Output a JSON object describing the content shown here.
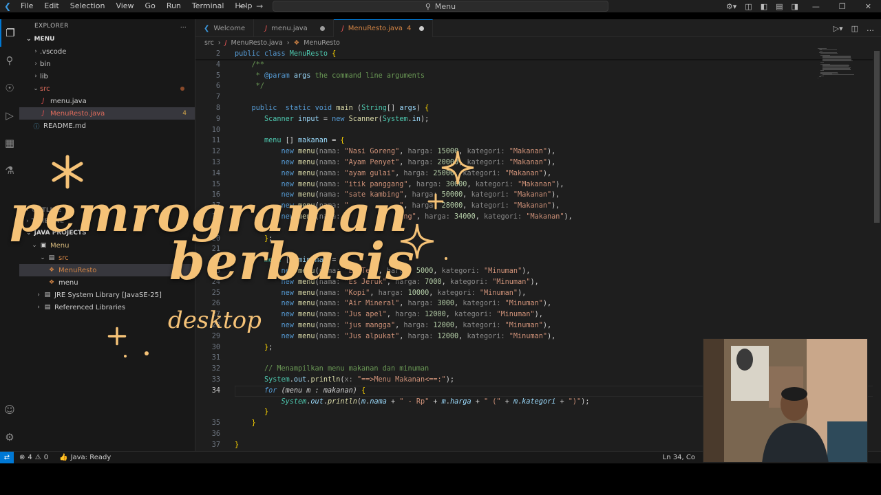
{
  "titlebar": {
    "menu": [
      "File",
      "Edit",
      "Selection",
      "View",
      "Go",
      "Run",
      "Terminal",
      "Help"
    ],
    "search": "Menu"
  },
  "sidebar": {
    "header": "EXPLORER",
    "folder": "MENU",
    "files": [
      {
        "label": ".vscode",
        "type": "folder"
      },
      {
        "label": "bin",
        "type": "folder"
      },
      {
        "label": "lib",
        "type": "folder"
      },
      {
        "label": "src",
        "type": "folder-open"
      },
      {
        "label": "menu.java",
        "type": "java"
      },
      {
        "label": "MenuResto.java",
        "type": "java",
        "badge": "4"
      },
      {
        "label": "README.md",
        "type": "md"
      }
    ],
    "outline_label": "OUTLINE",
    "timeline_label": "TIMELINE",
    "java_projects": "JAVA PROJECTS",
    "projects": [
      {
        "label": "Menu"
      },
      {
        "label": "src"
      },
      {
        "label": "MenuResto"
      },
      {
        "label": "menu"
      },
      {
        "label": "JRE System Library [JavaSE-25]"
      },
      {
        "label": "Referenced Libraries"
      }
    ]
  },
  "tabs": [
    {
      "label": "Welcome"
    },
    {
      "label": "menu.java"
    },
    {
      "label": "MenuResto.java",
      "badge": "4"
    }
  ],
  "breadcrumb": {
    "a": "src",
    "b": "MenuResto.java",
    "c": "MenuResto"
  },
  "status": {
    "errors": "4",
    "warnings": "0",
    "java": "Java: Ready",
    "position": "Ln 34, Co"
  },
  "overlay": {
    "line1": "pemrograman",
    "line2": "berbasis",
    "line3": "desktop"
  },
  "colors": {
    "accent": "#0078d4",
    "overlay_text": "#f5c277"
  },
  "code": [
    {
      "n": "2",
      "html": "<span class='kw'>public</span> <span class='kw'>class</span> <span class='ty'>MenuResto</span> <span class='br'>{</span>"
    },
    {
      "n": "4",
      "html": "    <span class='cm'>/**</span>"
    },
    {
      "n": "5",
      "html": "    <span class='cm'> * </span><span class='kw'>@param</span> <span class='var'>args</span><span class='cm'> the command line arguments</span>"
    },
    {
      "n": "6",
      "html": "    <span class='cm'> */</span>"
    },
    {
      "n": "7",
      "html": ""
    },
    {
      "n": "8",
      "html": "    <span class='kw'>public</span>  <span class='kw'>static</span> <span class='kw'>void</span> <span class='fn'>main</span> <span class='pl'>(</span><span class='ty'>String</span><span class='pl'>[]</span> <span class='var'>args</span><span class='pl'>)</span> <span class='br'>{</span>"
    },
    {
      "n": "9",
      "html": "       <span class='ty'>Scanner</span> <span class='var'>input</span> <span class='pl'>=</span> <span class='kw'>new</span> <span class='fn'>Scanner</span><span class='pl'>(</span><span class='ty'>System</span><span class='pl'>.</span><span class='var'>in</span><span class='pl'>);</span>"
    },
    {
      "n": "10",
      "html": ""
    },
    {
      "n": "11",
      "html": "       <span class='ty'>menu</span> <span class='pl'>[]</span> <span class='var'>makanan</span> <span class='pl'>=</span> <span class='br'>{</span>"
    },
    {
      "n": "12",
      "html": "           <span class='kw'>new</span> <span class='fn'>menu</span><span class='pl'>(</span><span class='hint'>nama:</span> <span class='str'>\"Nasi Goreng\"</span><span class='pl'>,</span> <span class='hint'>harga:</span> <span class='num'>15000</span><span class='pl'>,</span> <span class='hint'>kategori:</span> <span class='str'>\"Makanan\"</span><span class='pl'>),</span>"
    },
    {
      "n": "13",
      "html": "           <span class='kw'>new</span> <span class='fn'>menu</span><span class='pl'>(</span><span class='hint'>nama:</span> <span class='str'>\"Ayam Penyet\"</span><span class='pl'>,</span> <span class='hint'>harga:</span> <span class='num'>20000</span><span class='pl'>,</span> <span class='hint'>kategori:</span> <span class='str'>\"Makanan\"</span><span class='pl'>),</span>"
    },
    {
      "n": "14",
      "html": "           <span class='kw'>new</span> <span class='fn'>menu</span><span class='pl'>(</span><span class='hint'>nama:</span> <span class='str'>\"ayam gulai\"</span><span class='pl'>,</span> <span class='hint'>harga:</span> <span class='num'>25000</span><span class='pl'>,</span> <span class='hint'>kategori:</span> <span class='str'>\"Makanan\"</span><span class='pl'>),</span>"
    },
    {
      "n": "15",
      "html": "           <span class='kw'>new</span> <span class='fn'>menu</span><span class='pl'>(</span><span class='hint'>nama:</span> <span class='str'>\"itik panggang\"</span><span class='pl'>,</span> <span class='hint'>harga:</span> <span class='num'>30000</span><span class='pl'>,</span> <span class='hint'>kategori:</span> <span class='str'>\"Makanan\"</span><span class='pl'>),</span>"
    },
    {
      "n": "16",
      "html": "           <span class='kw'>new</span> <span class='fn'>menu</span><span class='pl'>(</span><span class='hint'>nama:</span> <span class='str'>\"sate kambing\"</span><span class='pl'>,</span> <span class='hint'>harga:</span> <span class='num'>50000</span><span class='pl'>,</span> <span class='hint'>kategori:</span> <span class='str'>\"Makanan\"</span><span class='pl'>),</span>"
    },
    {
      "n": "17",
      "html": "           <span class='kw'>new</span> <span class='fn'>menu</span><span class='pl'>(</span><span class='hint'>nama:</span> <span class='str'>\"            \"</span><span class='pl'>,</span> <span class='hint'>harga:</span> <span class='num'>28000</span><span class='pl'>,</span> <span class='hint'>kategori:</span> <span class='str'>\"Makanan\"</span><span class='pl'>),</span>"
    },
    {
      "n": "18",
      "html": "           <span class='kw'>new</span> <span class='fn'>menu</span><span class='pl'>(</span><span class='hint'>nama:</span> <span class='str'>\"            ang\"</span><span class='pl'>,</span> <span class='hint'>harga:</span> <span class='num'>34000</span><span class='pl'>,</span> <span class='hint'>kategori:</span> <span class='str'>\"Makanan\"</span><span class='pl'>),</span>"
    },
    {
      "n": "19",
      "html": ""
    },
    {
      "n": "20",
      "html": "       <span class='br'>}</span><span class='pl'>;</span>"
    },
    {
      "n": "21",
      "html": ""
    },
    {
      "n": "22",
      "html": "       <span class='ty'>menu</span> <span class='pl'>[]</span> <span class='var'>minuman</span> <span class='pl'>=</span> <span class='br'>{</span>"
    },
    {
      "n": "23",
      "html": "           <span class='kw'>new</span> <span class='fn'>menu</span><span class='pl'>(</span><span class='hint'>nama:</span> <span class='str'>\"Es Teh\"</span><span class='pl'>,</span> <span class='hint'>harga:</span> <span class='num'>5000</span><span class='pl'>,</span> <span class='hint'>kategori:</span> <span class='str'>\"Minuman\"</span><span class='pl'>),</span>"
    },
    {
      "n": "24",
      "html": "           <span class='kw'>new</span> <span class='fn'>menu</span><span class='pl'>(</span><span class='hint'>nama:</span> <span class='str'>\"Es Jeruk\"</span><span class='pl'>,</span> <span class='hint'>harga:</span> <span class='num'>7000</span><span class='pl'>,</span> <span class='hint'>kategori:</span> <span class='str'>\"Minuman\"</span><span class='pl'>),</span>"
    },
    {
      "n": "25",
      "html": "           <span class='kw'>new</span> <span class='fn'>menu</span><span class='pl'>(</span><span class='hint'>nama:</span> <span class='str'>\"Kopi\"</span><span class='pl'>,</span> <span class='hint'>harga:</span> <span class='num'>10000</span><span class='pl'>,</span> <span class='hint'>kategori:</span> <span class='str'>\"Minuman\"</span><span class='pl'>),</span>"
    },
    {
      "n": "26",
      "html": "           <span class='kw'>new</span> <span class='fn'>menu</span><span class='pl'>(</span><span class='hint'>nama:</span> <span class='str'>\"Air Mineral\"</span><span class='pl'>,</span> <span class='hint'>harga:</span> <span class='num'>3000</span><span class='pl'>,</span> <span class='hint'>kategori:</span> <span class='str'>\"Minuman\"</span><span class='pl'>),</span>"
    },
    {
      "n": "27",
      "html": "           <span class='kw'>new</span> <span class='fn'>menu</span><span class='pl'>(</span><span class='hint'>nama:</span> <span class='str'>\"Jus apel\"</span><span class='pl'>,</span> <span class='hint'>harga:</span> <span class='num'>12000</span><span class='pl'>,</span> <span class='hint'>kategori:</span> <span class='str'>\"Minuman\"</span><span class='pl'>),</span>"
    },
    {
      "n": "28",
      "html": "           <span class='kw'>new</span> <span class='fn'>menu</span><span class='pl'>(</span><span class='hint'>nama:</span> <span class='str'>\"jus mangga\"</span><span class='pl'>,</span> <span class='hint'>harga:</span> <span class='num'>12000</span><span class='pl'>,</span> <span class='hint'>kategori:</span> <span class='str'>\"Minuman\"</span><span class='pl'>),</span>"
    },
    {
      "n": "29",
      "html": "           <span class='kw'>new</span> <span class='fn'>menu</span><span class='pl'>(</span><span class='hint'>nama:</span> <span class='str'>\"Jus alpukat\"</span><span class='pl'>,</span> <span class='hint'>harga:</span> <span class='num'>12000</span><span class='pl'>,</span> <span class='hint'>kategori:</span> <span class='str'>\"Minuman\"</span><span class='pl'>),</span>"
    },
    {
      "n": "30",
      "html": "       <span class='br'>}</span><span class='pl'>;</span>"
    },
    {
      "n": "31",
      "html": ""
    },
    {
      "n": "32",
      "html": "       <span class='cm'>// Menampilkan menu makanan dan minuman</span>"
    },
    {
      "n": "33",
      "html": "       <span class='ty'>System</span><span class='pl'>.</span><span class='var'>out</span><span class='pl'>.</span><span class='fn'>println</span><span class='pl'>(</span><span class='hint'>x:</span> <span class='str'>\"==>Menu Makanan<==:\"</span><span class='pl'>);</span>"
    },
    {
      "n": "34",
      "html": "       <span class='kw' style='font-style:italic'>for</span> <span class='pl' style='font-style:italic'>(menu m : makanan)</span> <span class='br'>{</span>"
    },
    {
      "n": "",
      "html": "           <span class='ty' style='font-style:italic'>System</span><span class='pl'>.</span><span class='var' style='font-style:italic'>out</span><span class='pl'>.</span><span class='fn' style='font-style:italic'>println</span><span class='pl'>(</span><span class='var' style='font-style:italic'>m</span><span class='pl'>.</span><span class='var' style='font-style:italic'>nama</span> <span class='pl'>+</span> <span class='str'>\" - Rp\"</span> <span class='pl'>+</span> <span class='var' style='font-style:italic'>m</span><span class='pl'>.</span><span class='var' style='font-style:italic'>harga</span> <span class='pl'>+</span> <span class='str'>\" (\"</span> <span class='pl'>+</span> <span class='var' style='font-style:italic'>m</span><span class='pl'>.</span><span class='var' style='font-style:italic'>kategori</span> <span class='pl'>+</span> <span class='str'>\")\"</span><span class='pl'>);</span>"
    },
    {
      "n": "",
      "html": "       <span class='br'>}</span>"
    },
    {
      "n": "35",
      "html": "    <span class='br'>}</span>"
    },
    {
      "n": "36",
      "html": ""
    },
    {
      "n": "37",
      "html": "<span class='br'>}</span>"
    }
  ]
}
